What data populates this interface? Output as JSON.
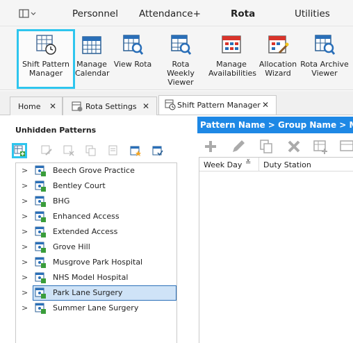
{
  "menubar": {
    "tabs": [
      {
        "label": "Personnel",
        "active": false
      },
      {
        "label": "Attendance+",
        "active": false
      },
      {
        "label": "Rota",
        "active": true
      },
      {
        "label": "Utilities",
        "active": false
      }
    ]
  },
  "ribbon": {
    "buttons": [
      {
        "label": "Shift Pattern Manager",
        "icon": "shift-pattern-manager-icon",
        "active": true
      },
      {
        "label": "Manage Calendar",
        "icon": "calendar-icon"
      },
      {
        "label": "View Rota",
        "icon": "view-rota-icon"
      },
      {
        "label": "Rota Weekly Viewer",
        "icon": "rota-weekly-viewer-icon"
      },
      {
        "label": "Manage Availabilities",
        "icon": "availabilities-icon"
      },
      {
        "label": "Allocation Wizard",
        "icon": "allocation-wizard-icon"
      },
      {
        "label": "Rota Archive Viewer",
        "icon": "rota-archive-viewer-icon"
      }
    ]
  },
  "doc_tabs": [
    {
      "label": "Home",
      "close": "✕"
    },
    {
      "label": "Rota Settings",
      "close": "✕"
    },
    {
      "label": "Shift Pattern Manager",
      "close": "✕",
      "active": true
    }
  ],
  "left_panel": {
    "title": "Unhidden Patterns",
    "tree_items": [
      "Beech Grove Practice",
      "Bentley Court",
      "BHG",
      "Enhanced Access",
      "Extended Access",
      "Grove Hill",
      "Musgrove Park Hospital",
      "NHS Model Hospital",
      "Park Lane Surgery",
      "Summer Lane Surgery"
    ],
    "selected_item": "Park Lane Surgery"
  },
  "right_panel": {
    "header": "Pattern Name > Group Name > M",
    "grid_columns": [
      "Week Day",
      "Duty Station"
    ]
  },
  "colors": {
    "accent": "#2ec5ee",
    "header_blue": "#1e88e5",
    "selection": "#cfe3f7"
  }
}
